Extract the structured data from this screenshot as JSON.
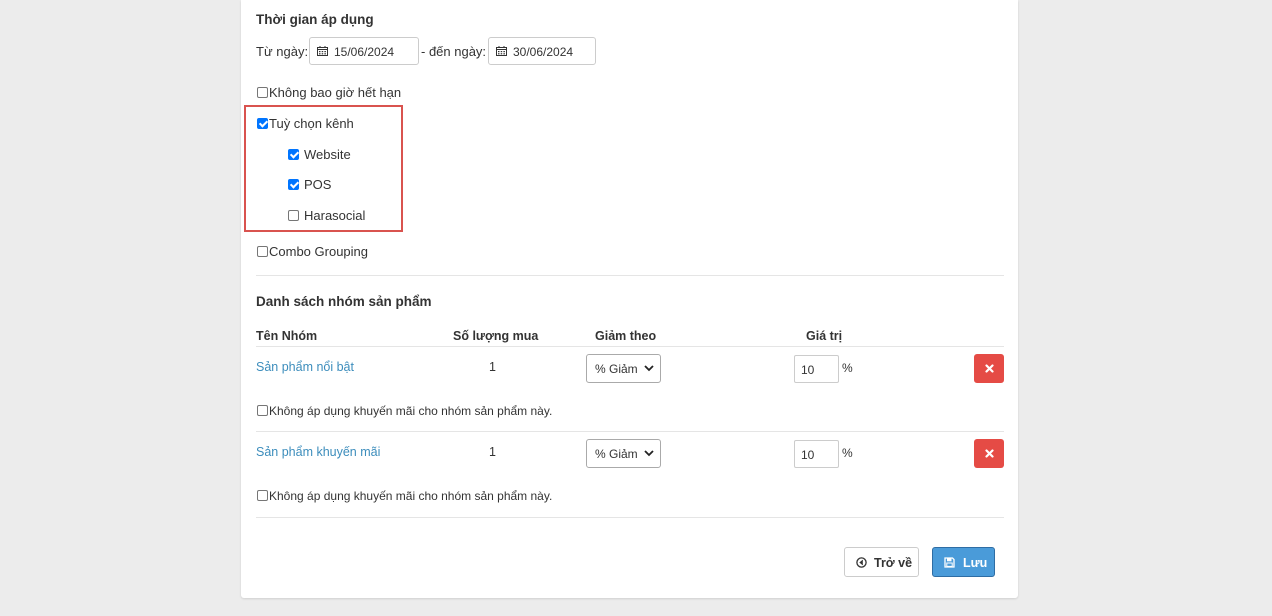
{
  "time_section": {
    "title": "Thời gian áp dụng",
    "from_label": "Từ ngày:",
    "from_value": "15/06/2024",
    "to_label": "- đến ngày:",
    "to_value": "30/06/2024"
  },
  "options": {
    "never_expire": {
      "label": "Không bao giờ hết hạn",
      "checked": false
    },
    "channel_option": {
      "label": "Tuỳ chọn kênh",
      "checked": true
    },
    "channels": [
      {
        "label": "Website",
        "checked": true
      },
      {
        "label": "POS",
        "checked": true
      },
      {
        "label": "Harasocial",
        "checked": false
      }
    ],
    "combo_grouping": {
      "label": "Combo Grouping",
      "checked": false
    }
  },
  "group_section": {
    "title": "Danh sách nhóm sản phẩm",
    "columns": [
      "Tên Nhóm",
      "Số lượng mua",
      "Giảm theo",
      "Giá trị"
    ],
    "rows": [
      {
        "name": "Sản phẩm nổi bật",
        "quantity": "1",
        "discount_type": "% Giảm",
        "value": "10",
        "unit": "%",
        "exclude_label": "Không áp dụng khuyến mãi cho nhóm sản phẩm này.",
        "exclude_checked": false
      },
      {
        "name": "Sản phẩm khuyến mãi",
        "quantity": "1",
        "discount_type": "% Giảm",
        "value": "10",
        "unit": "%",
        "exclude_label": "Không áp dụng khuyến mãi cho nhóm sản phẩm này.",
        "exclude_checked": false
      }
    ]
  },
  "footer": {
    "back_label": "Trở về",
    "save_label": "Lưu"
  },
  "colors": {
    "highlight": "#d9534f",
    "link": "#3c8dbc",
    "checkbox": "#0075ff",
    "delete": "#e54b45",
    "save": "#4a9bd9"
  }
}
